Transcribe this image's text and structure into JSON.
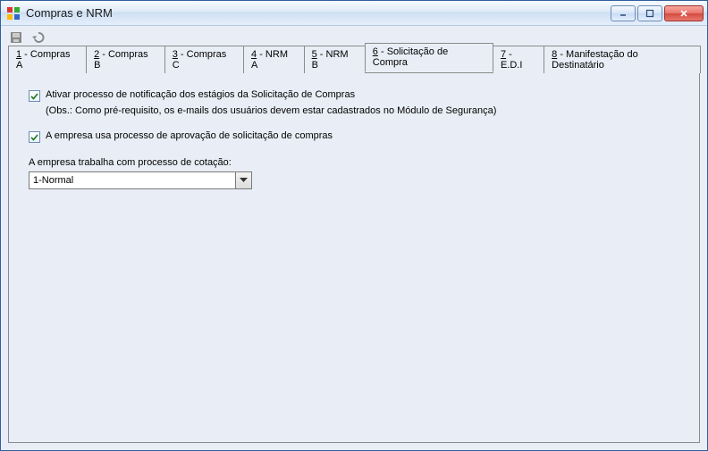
{
  "window": {
    "title": "Compras e NRM"
  },
  "toolbar": {
    "save_icon": "save-icon",
    "undo_icon": "undo-icon"
  },
  "tabs": [
    {
      "hotkey": "1",
      "label": " - Compras A"
    },
    {
      "hotkey": "2",
      "label": " - Compras B"
    },
    {
      "hotkey": "3",
      "label": " - Compras C"
    },
    {
      "hotkey": "4",
      "label": " - NRM A"
    },
    {
      "hotkey": "5",
      "label": " - NRM B"
    },
    {
      "hotkey": "6",
      "label": " - Solicitação de Compra"
    },
    {
      "hotkey": "7",
      "label": " - E.D.I"
    },
    {
      "hotkey": "8",
      "label": " - Manifestação do Destinatário"
    }
  ],
  "active_tab_index": 5,
  "content": {
    "check1_label": "Ativar processo de notificação dos estágios da Solicitação de Compras",
    "check1_checked": true,
    "obs": "(Obs.: Como pré-requisito, os e-mails dos usuários devem estar cadastrados no Módulo de Segurança)",
    "check2_label": "A empresa usa processo de aprovação de solicitação de compras",
    "check2_checked": true,
    "cotacao_label": "A empresa trabalha com processo de cotação:",
    "cotacao_value": "1-Normal"
  }
}
